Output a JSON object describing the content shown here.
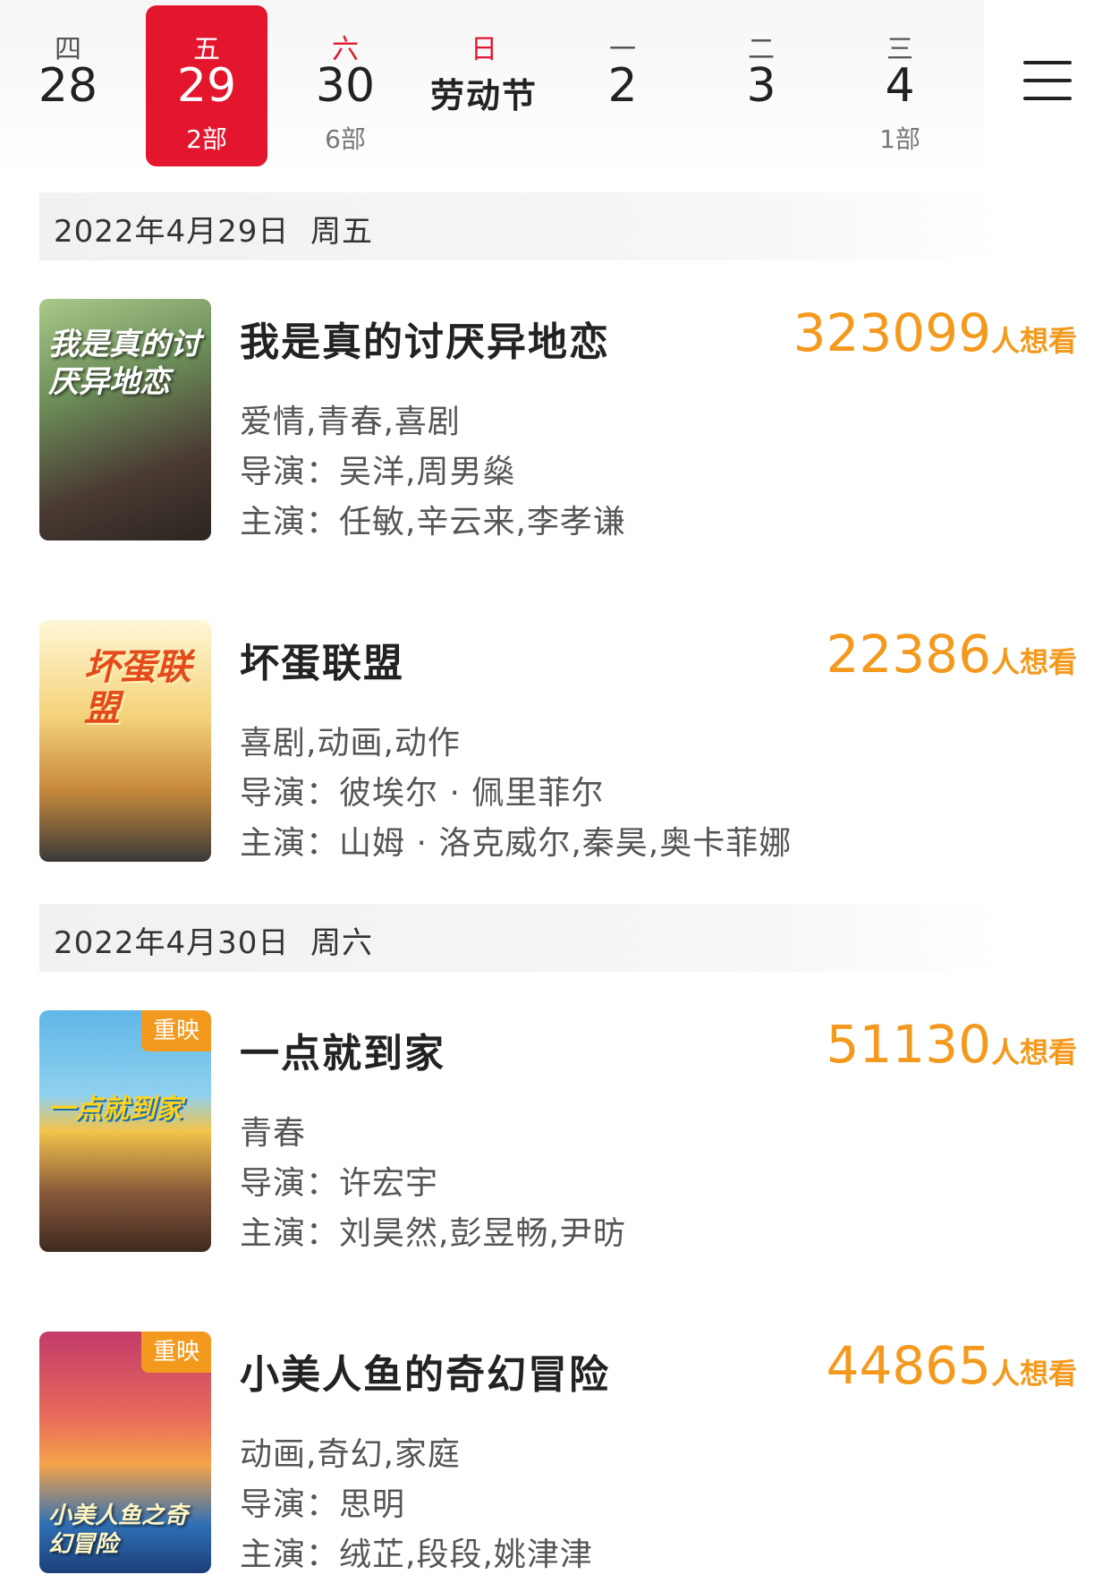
{
  "date_strip": {
    "days": [
      {
        "weekday": "四",
        "day": "28",
        "count": ""
      },
      {
        "weekday": "五",
        "day": "29",
        "count": "2部"
      },
      {
        "weekday": "六",
        "day": "30",
        "count": "6部"
      },
      {
        "weekday": "日",
        "day": "劳动节",
        "count": ""
      },
      {
        "weekday": "一",
        "day": "2",
        "count": ""
      },
      {
        "weekday": "二",
        "day": "3",
        "count": ""
      },
      {
        "weekday": "三",
        "day": "4",
        "count": "1部"
      }
    ],
    "selected_index": 1,
    "accent_color": "#e3162e"
  },
  "menu": {
    "icon": "hamburger-menu-icon"
  },
  "sections": [
    {
      "date": "2022年4月29日",
      "weekday": "周五",
      "movies": [
        {
          "title": "我是真的讨厌异地恋",
          "want_count": "323099",
          "want_unit": "人想看",
          "genres": "爱情,青春,喜剧",
          "director_label": "导演：",
          "directors": "吴洋,周男燊",
          "cast_label": "主演：",
          "cast": "任敏,辛云来,李孝谦",
          "poster_text": "我是真的讨厌异地恋",
          "badge": ""
        },
        {
          "title": "坏蛋联盟",
          "want_count": "22386",
          "want_unit": "人想看",
          "genres": "喜剧,动画,动作",
          "director_label": "导演：",
          "directors": "彼埃尔 · 佩里菲尔",
          "cast_label": "主演：",
          "cast": "山姆 · 洛克威尔,秦昊,奥卡菲娜",
          "poster_text": "坏蛋联盟",
          "badge": ""
        }
      ]
    },
    {
      "date": "2022年4月30日",
      "weekday": "周六",
      "movies": [
        {
          "title": "一点就到家",
          "want_count": "51130",
          "want_unit": "人想看",
          "genres": "青春",
          "director_label": "导演：",
          "directors": "许宏宇",
          "cast_label": "主演：",
          "cast": "刘昊然,彭昱畅,尹昉",
          "poster_text": "一点就到家",
          "badge": "重映"
        },
        {
          "title": "小美人鱼的奇幻冒险",
          "want_count": "44865",
          "want_unit": "人想看",
          "genres": "动画,奇幻,家庭",
          "director_label": "导演：",
          "directors": "思明",
          "cast_label": "主演：",
          "cast": "绒芷,段段,姚津津",
          "poster_text": "小美人鱼之奇幻冒险",
          "badge": "重映"
        }
      ]
    }
  ],
  "colors": {
    "accent": "#e3162e",
    "want": "#f39a1e",
    "badge": "#f39a1e"
  }
}
